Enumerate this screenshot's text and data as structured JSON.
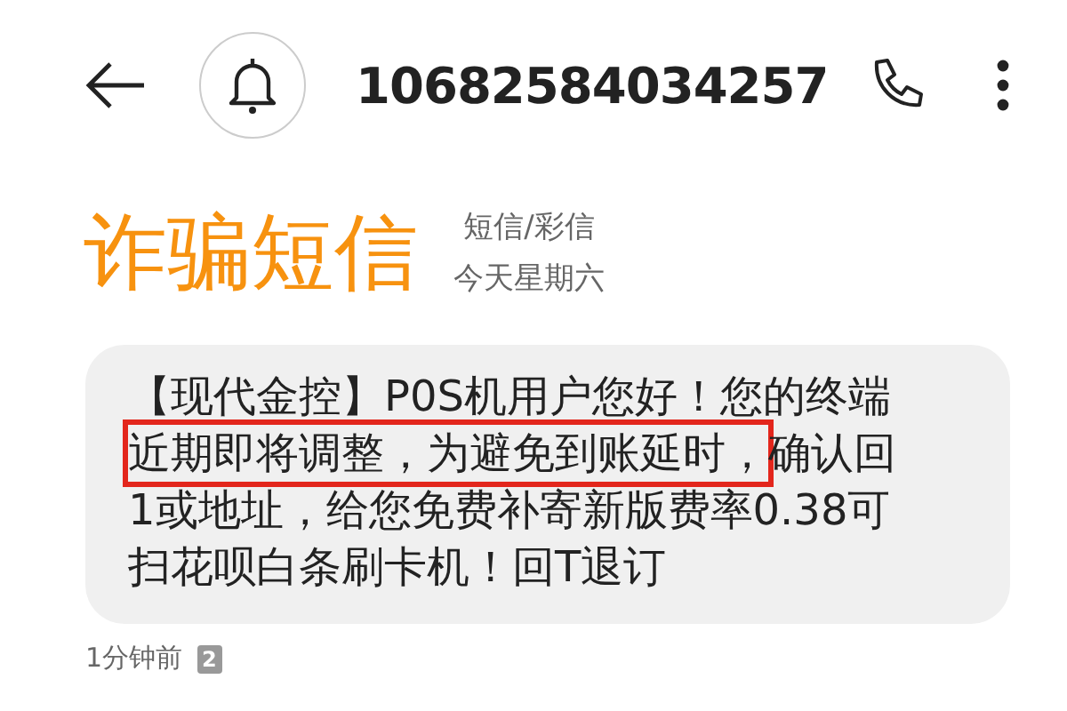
{
  "header": {
    "sender": "10682584034257"
  },
  "label": {
    "title": "诈骗短信",
    "type": "短信/彩信",
    "date": "今天星期六"
  },
  "message": {
    "segments": [
      {
        "text": "【现代金控】P0S机用户您好！您的终端",
        "highlighted": false
      },
      {
        "text": "近期即将调整，为避免到账延时，",
        "highlighted": true
      },
      {
        "text": "确认回1或地址，给您免费补寄新版费率0.38可扫花呗白条刷卡机！回T退订",
        "highlighted": false
      }
    ],
    "time": "1分钟前",
    "sim": "2"
  }
}
